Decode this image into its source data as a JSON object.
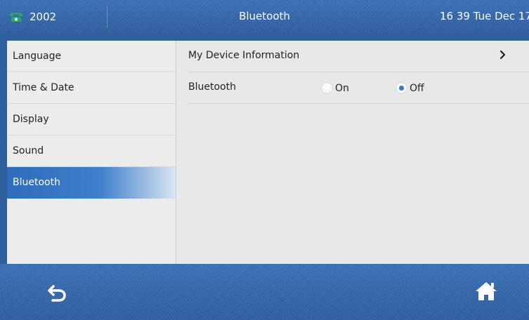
{
  "status_bar": {
    "line_number": "2002",
    "title": "Bluetooth",
    "datetime": "16 39 Tue Dec 17",
    "icons": {
      "line": "phone-handset-icon"
    }
  },
  "sidebar": {
    "items": [
      {
        "label": "Language"
      },
      {
        "label": "Time & Date"
      },
      {
        "label": "Display"
      },
      {
        "label": "Sound"
      },
      {
        "label": "Bluetooth",
        "selected": true
      }
    ]
  },
  "main": {
    "rows": [
      {
        "label": "My Device Information",
        "icon": "chevron-right-icon"
      },
      {
        "label": "Bluetooth",
        "options": [
          {
            "label": "On",
            "checked": false
          },
          {
            "label": "Off",
            "checked": true
          }
        ]
      }
    ]
  },
  "bottom_bar": {
    "back_icon": "back-arrow-icon",
    "home_icon": "home-icon"
  },
  "colors": {
    "bar_blue": "#3567a8",
    "selected_blue": "#2f6cb9",
    "radio_dot": "#3a78c8",
    "phone_green": "#2fa36b"
  }
}
